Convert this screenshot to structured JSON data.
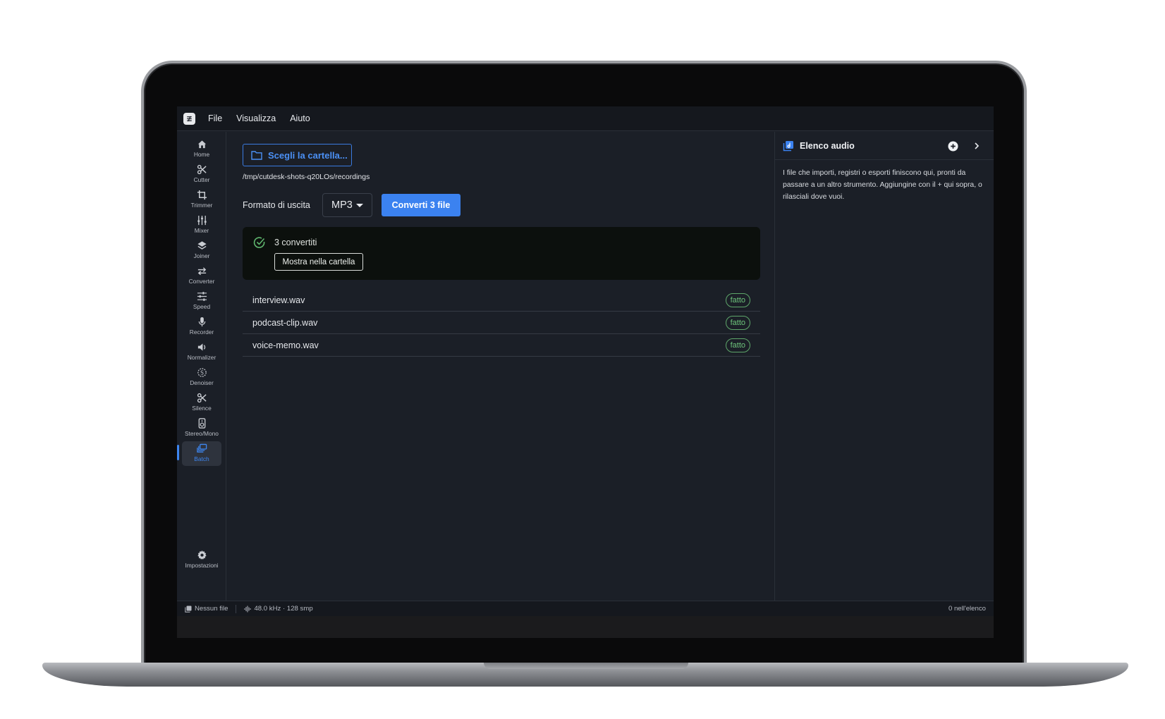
{
  "menubar": {
    "items": [
      "File",
      "Visualizza",
      "Aiuto"
    ]
  },
  "sidebar": {
    "items": [
      {
        "label": "Home",
        "icon": "home-icon"
      },
      {
        "label": "Cutter",
        "icon": "scissors-icon"
      },
      {
        "label": "Trimmer",
        "icon": "crop-icon"
      },
      {
        "label": "Mixer",
        "icon": "mixer-icon"
      },
      {
        "label": "Joiner",
        "icon": "layers-icon"
      },
      {
        "label": "Converter",
        "icon": "swap-icon"
      },
      {
        "label": "Speed",
        "icon": "sliders-icon"
      },
      {
        "label": "Recorder",
        "icon": "microphone-icon"
      },
      {
        "label": "Normalizer",
        "icon": "volume-icon"
      },
      {
        "label": "Denoiser",
        "icon": "denoise-icon"
      },
      {
        "label": "Silence",
        "icon": "scissors-icon"
      },
      {
        "label": "Stereo/Mono",
        "icon": "speaker-icon"
      },
      {
        "label": "Batch",
        "icon": "batch-icon"
      }
    ],
    "active": "Batch",
    "settings_label": "Impostazioni"
  },
  "main": {
    "choose_folder_label": "Scegli la cartella...",
    "folder_path": "/tmp/cutdesk-shots-q20LOs/recordings",
    "format_label": "Formato di uscita",
    "format_value": "MP3",
    "convert_label": "Converti 3 file",
    "result": {
      "text": "3 convertiti",
      "show_label": "Mostra nella cartella"
    },
    "files": [
      {
        "name": "interview.wav",
        "status": "fatto"
      },
      {
        "name": "podcast-clip.wav",
        "status": "fatto"
      },
      {
        "name": "voice-memo.wav",
        "status": "fatto"
      }
    ]
  },
  "right_panel": {
    "title": "Elenco audio",
    "description": "I file che importi, registri o esporti finiscono qui, pronti da passare a un altro strumento. Aggiungine con il + qui sopra, o rilasciali dove vuoi."
  },
  "statusbar": {
    "file": "Nessun file",
    "audio": "48.0 kHz · 128 smp",
    "count": "0 nell'elenco"
  },
  "colors": {
    "accent": "#3b82f0",
    "success": "#6ec57c",
    "background": "#1b1f27"
  }
}
